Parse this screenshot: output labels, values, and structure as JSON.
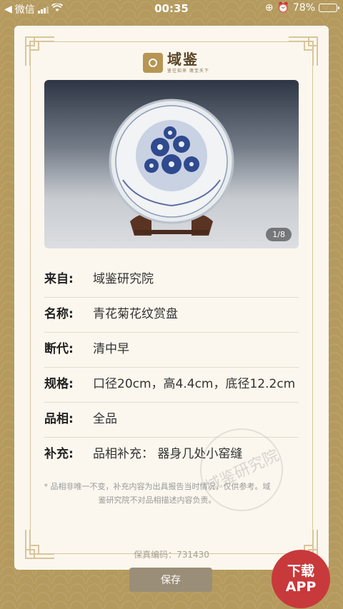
{
  "status_bar": {
    "back_app": "微信",
    "time": "00:35",
    "battery": "78%",
    "battery_level": 0.78
  },
  "logo": {
    "name": "域鉴",
    "tagline": "鉴往知来 瑰宝天下"
  },
  "photo": {
    "counter": "1/8"
  },
  "details": [
    {
      "key": "来自:",
      "value": "域鉴研究院"
    },
    {
      "key": "名称:",
      "value": "青花菊花纹赏盘"
    },
    {
      "key": "断代:",
      "value": "清中早"
    },
    {
      "key": "规格:",
      "value": "口径20cm，高4.4cm，底径12.2cm"
    },
    {
      "key": "品相:",
      "value": "全品"
    },
    {
      "key": "补充:",
      "value": "品相补充：  器身几处小窑缝"
    }
  ],
  "note": "* 品相非唯一不变，补充内容为出具报告当时情况，仅供参考。域鉴研究院不对品相描述内容负责。",
  "stamp_text": "域鉴研究院",
  "cert": "保真编码：731430",
  "save_label": "保存",
  "download": {
    "line1": "下载",
    "line2": "APP"
  }
}
